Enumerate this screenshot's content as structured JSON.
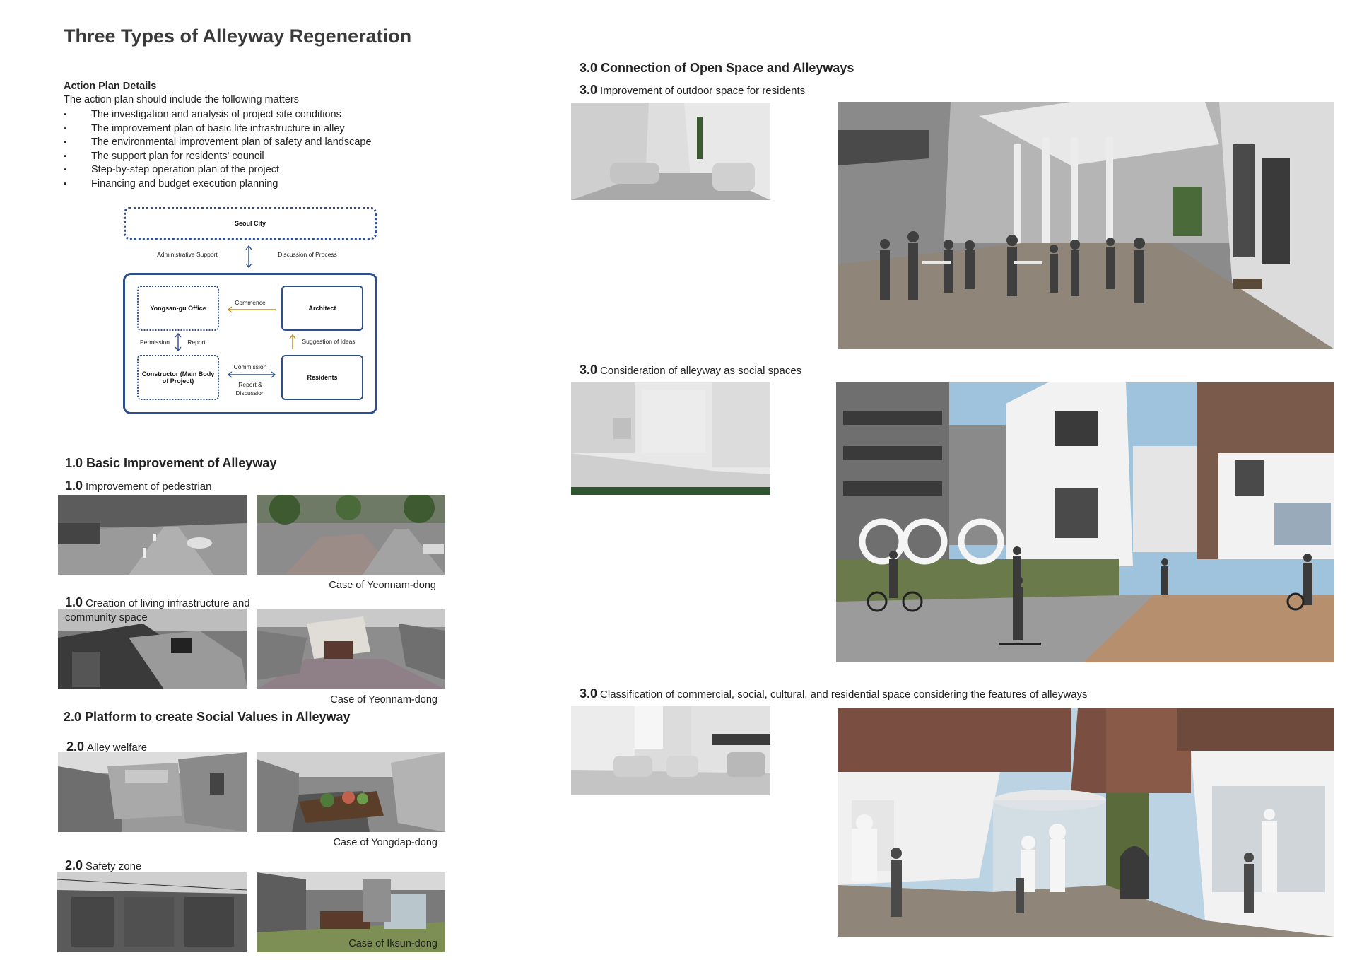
{
  "page_title": "Three Types of Alleyway Regeneration",
  "action_plan": {
    "heading": "Action Plan Details",
    "intro": "The action plan should include the following matters",
    "items": [
      "The investigation and analysis of project site conditions",
      "The improvement plan of basic life infrastructure in alley",
      "The environmental improvement plan of safety and landscape",
      "The support plan for residents' council",
      "Step-by-step operation plan of the project",
      "Financing and budget execution planning"
    ]
  },
  "diagram": {
    "seoul_city": "Seoul City",
    "admin_support": "Administrative Support",
    "discussion": "Discussion of Process",
    "yongsan": "Yongsan-gu Office",
    "architect": "Architect",
    "commence": "Commence",
    "permission": "Permission",
    "report": "Report",
    "suggestion": "Suggestion of Ideas",
    "constructor": "Constructor (Main Body of Project)",
    "commission": "Commission",
    "report_discussion": "Report & Discussion",
    "residents": "Residents"
  },
  "section1": {
    "heading": "1.0 Basic Improvement of Alleyway",
    "sub1_num": "1.0",
    "sub1_label": "Improvement of pedestrian",
    "sub1_caption": "Case of Yeonnam-dong",
    "sub2_num": "1.0",
    "sub2_label": "Creation of living infrastructure and community space",
    "sub2_caption": "Case of Yeonnam-dong"
  },
  "section2": {
    "heading": "2.0 Platform to create Social Values in Alleyway",
    "sub1_num": "2.0",
    "sub1_label": "Alley welfare",
    "sub1_caption": "Case of Yongdap-dong",
    "sub2_num": "2.0",
    "sub2_label": "Safety zone",
    "sub2_caption": "Case of Iksun-dong"
  },
  "section3": {
    "heading": "3.0 Connection of Open Space and Alleyways",
    "sub1_num": "3.0",
    "sub1_label": "Improvement of outdoor space for residents",
    "sub2_num": "3.0",
    "sub2_label": "Consideration of alleyway as social spaces",
    "sub3_num": "3.0",
    "sub3_label": "Classification of commercial, social, cultural, and residential space considering the features of alleyways"
  }
}
